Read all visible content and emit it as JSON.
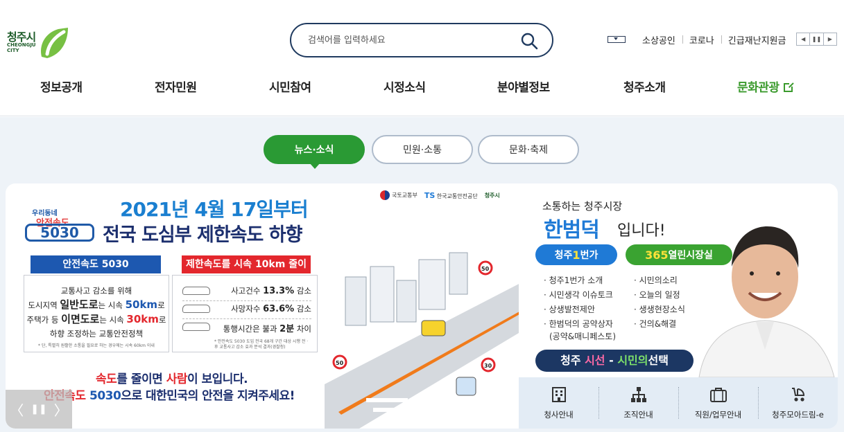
{
  "header": {
    "logo": {
      "name": "청주시",
      "sub": "CHEONGJU CITY"
    },
    "search": {
      "placeholder": "검색어를 입력하세요"
    },
    "keywords": [
      "소상공인",
      "코로나",
      "긴급재난지원금"
    ],
    "keyword_controls": {
      "prev": "◀",
      "pause": "❚❚",
      "next": "▶"
    },
    "nav": [
      "정보공개",
      "전자민원",
      "시민참여",
      "시정소식",
      "분야별정보",
      "청주소개",
      "문화관광"
    ]
  },
  "tabs": [
    "뉴스·소식",
    "민원·소통",
    "문화·축제"
  ],
  "active_tab": 0,
  "banner": {
    "title1": "2021년 4월 17일부터",
    "title2": "전국 도심부 제한속도 하향",
    "badge": {
      "line1": "우리동네",
      "line2": "안전속도",
      "line3": "5030"
    },
    "org_logos": [
      "국토교통부",
      "한국교통안전공단",
      "청주시"
    ],
    "left_head": "안전속도 5030",
    "left_lines": {
      "l1": "교통사고 감소를 위해",
      "l2a": "도시지역 ",
      "l2b": "일반도로",
      "l2c": "는 시속 ",
      "l2d": "50km",
      "l2e": "로",
      "l3a": "주택가 등 ",
      "l3b": "이면도로",
      "l3c": "는 시속 ",
      "l3d": "30km",
      "l3e": "로",
      "l4": "하향 조정하는 교통안전정책",
      "note": "* 단, 특별히 원활한 소통을 필요로 하는 경우에는 시속 60km 이내"
    },
    "right_head": "제한속도를 시속 10km 줄이면?",
    "right_rows": [
      {
        "label": "사고건수 ",
        "value": "13.3%",
        "suffix": " 감소"
      },
      {
        "label": "사망자수 ",
        "value": "63.6%",
        "suffix": " 감소"
      },
      {
        "label": "통행시간은 불과 ",
        "value": "2분",
        "suffix": " 차이"
      }
    ],
    "right_note": "* 안전속도 5030 도입 전국 68개 구간 대상 시행 전 · 후 교통사고 감소 효과 분석 결과(경찰청)",
    "bottom1": {
      "a": "속도",
      "b": "를 줄이면 ",
      "c": "사람",
      "d": "이 보입니다."
    },
    "bottom2": {
      "a": "안전속도 ",
      "b": "5030",
      "c": "으로 대한민국의 안전을 지켜주세요!"
    },
    "sign_values": [
      "50",
      "50",
      "30"
    ],
    "controls": {
      "prev": "〈",
      "pause": "❚❚",
      "next": "〉"
    }
  },
  "mayor": {
    "subtitle": "소통하는 청주시장",
    "name": "한범덕",
    "suffix": "입니다!",
    "btn1": {
      "a": "청주",
      "b": "1",
      "c": "번가"
    },
    "btn2": {
      "a": "365",
      "b": "열린시장실"
    },
    "list_left": [
      "청주1번가 소개",
      "시민생각 이슈토크",
      "상생발전제안",
      "한범덕의 공약상자",
      "(공약&매니페스토)"
    ],
    "list_right": [
      "시민의소리",
      "오늘의 일정",
      "생생현장소식",
      "건의&해결"
    ],
    "sisun": {
      "a": "청주 ",
      "b": "시선",
      "c": " - ",
      "d": "시민의",
      "e": "선택"
    }
  },
  "quick_links": [
    {
      "label": "청사안내",
      "icon": "building-icon"
    },
    {
      "label": "조직안내",
      "icon": "org-chart-icon"
    },
    {
      "label": "직원/업무안내",
      "icon": "briefcase-icon"
    },
    {
      "label": "청주모아드림-e",
      "icon": "stroller-icon"
    }
  ],
  "colors": {
    "accent_green": "#2a9a34",
    "navy": "#1f3a5f",
    "blue": "#1f7ad6",
    "red": "#e3272d"
  }
}
